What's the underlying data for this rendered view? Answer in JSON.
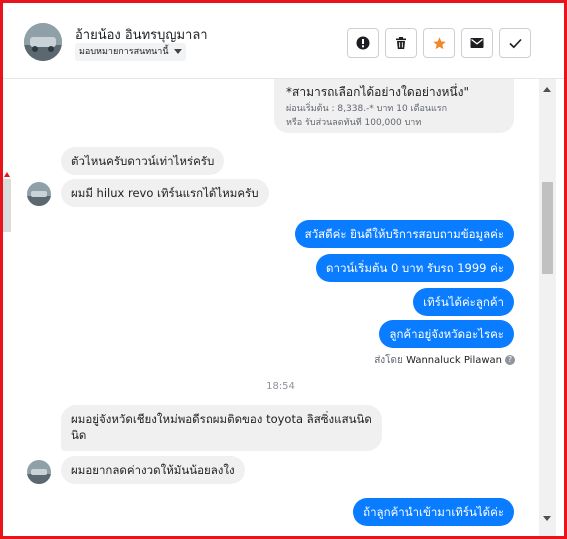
{
  "header": {
    "contact_name": "อ้ายน้อง อินทรบุญมาลา",
    "assign_label": "มอบหมายการสนทนานี้",
    "actions": [
      {
        "name": "spam-button",
        "icon": "exclamation-circle-icon"
      },
      {
        "name": "delete-button",
        "icon": "trash-icon"
      },
      {
        "name": "star-button",
        "icon": "star-icon",
        "color": "#f0892b"
      },
      {
        "name": "mark-unread-button",
        "icon": "envelope-icon"
      },
      {
        "name": "done-button",
        "icon": "checkmark-icon"
      }
    ]
  },
  "card": {
    "title": "*สามารถเลือกได้อย่างใดอย่างหนึ่ง\"",
    "line1": "ผ่อนเริ่มต้น : 8,338.-* บาท 10 เดือนแรก",
    "line2": "หรือ รับส่วนลดทันที 100,000 บาท"
  },
  "messages": [
    {
      "dir": "in",
      "text": "ตัวไหนครับดาวน์เท่าไหร่ครับ"
    },
    {
      "dir": "in",
      "text": "ผมมี hilux revo เทิร์นแรกได้ไหมครับ"
    },
    {
      "dir": "out",
      "text": "สวัสดีค่ะ  ยินดีให้บริการสอบถามข้อมูลค่ะ"
    },
    {
      "dir": "out",
      "text": "ดาวน์เริ่มต้น 0 บาท รับรถ 1999 ค่ะ"
    },
    {
      "dir": "out",
      "text": "เทิร์นได้ค่ะลูกค้า"
    },
    {
      "dir": "out",
      "text": "ลูกค้าอยู่จังหวัดอะไรคะ"
    },
    {
      "dir": "in",
      "text": "ผมอยู่จังหวัดเชียงใหม่พอดีรถผมติดของ toyota ลิสซิ่งแสนนิด"
    },
    {
      "dir": "in",
      "text": "นิด"
    },
    {
      "dir": "in",
      "text": "ผมอยากลดค่างวดให้มันน้อยลงใง"
    },
    {
      "dir": "out",
      "text": "ถ้าลูกค้านำเข้ามาเทิร์นได้ค่ะ"
    }
  ],
  "sent_by": {
    "prefix": "ส่งโดย",
    "name": "Wannaluck Pilawan",
    "help": "?"
  },
  "timestamp": "18:54",
  "colors": {
    "frame": "#e8141c",
    "outgoing": "#0a7cff",
    "incoming": "#f1f0f0"
  }
}
